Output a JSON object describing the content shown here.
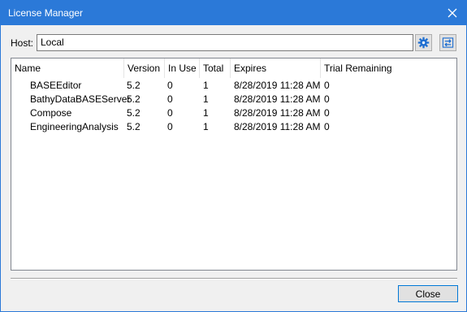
{
  "window": {
    "title": "License Manager"
  },
  "host": {
    "label": "Host:",
    "value": "Local"
  },
  "table": {
    "columns": [
      "Name",
      "Version",
      "In Use",
      "Total",
      "Expires",
      "Trial Remaining"
    ],
    "rows": [
      [
        "BASEEditor",
        "5.2",
        "0",
        "1",
        "8/28/2019 11:28 AM",
        "0"
      ],
      [
        "BathyDataBASEServer",
        "5.2",
        "0",
        "1",
        "8/28/2019 11:28 AM",
        "0"
      ],
      [
        "Compose",
        "5.2",
        "0",
        "1",
        "8/28/2019 11:28 AM",
        "0"
      ],
      [
        "EngineeringAnalysis",
        "5.2",
        "0",
        "1",
        "8/28/2019 11:28 AM",
        "0"
      ]
    ]
  },
  "footer": {
    "close_label": "Close"
  },
  "icons": {
    "settings": "gear-icon",
    "swap": "swap-arrows-icon",
    "close": "close-icon"
  },
  "colors": {
    "titlebar": "#2b79d8",
    "accent": "#0078d7"
  }
}
